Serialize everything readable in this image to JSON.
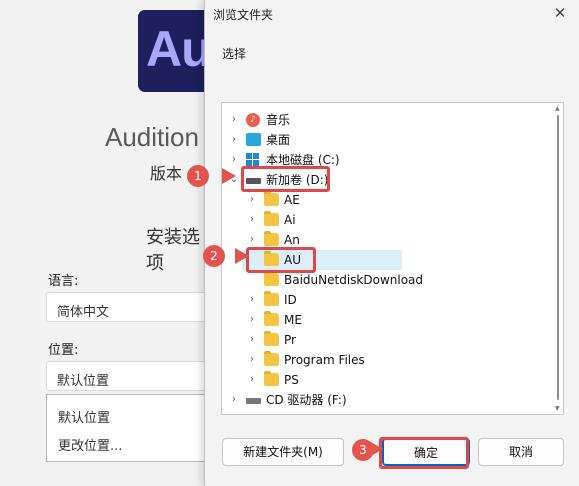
{
  "background_app": {
    "logo_text": "Au",
    "app_title": "Audition",
    "version_label": "版本",
    "install_options_title": "安装选项",
    "language_label": "语言:",
    "language_value": "简体中文",
    "location_label": "位置:",
    "location_value": "默认位置",
    "location_options": [
      "默认位置",
      "更改位置..."
    ]
  },
  "dialog": {
    "title": "浏览文件夹",
    "close_glyph": "✕",
    "prompt": "选择",
    "tree": [
      {
        "label": "音乐",
        "icon": "music-icon",
        "chevron": "›"
      },
      {
        "label": "桌面",
        "icon": "desktop-icon",
        "chevron": "›"
      },
      {
        "label": "本地磁盘 (C:)",
        "icon": "windows-drive-icon",
        "chevron": "›"
      },
      {
        "label": "新加卷 (D:)",
        "icon": "drive-icon",
        "chevron": "⌄"
      },
      {
        "label": "AE",
        "icon": "folder-icon",
        "chevron": "›"
      },
      {
        "label": "Ai",
        "icon": "folder-icon",
        "chevron": "›"
      },
      {
        "label": "An",
        "icon": "folder-icon",
        "chevron": "›"
      },
      {
        "label": "AU",
        "icon": "folder-icon",
        "chevron": "",
        "selected": true
      },
      {
        "label": "BaiduNetdiskDownload",
        "icon": "folder-icon",
        "chevron": ""
      },
      {
        "label": "ID",
        "icon": "folder-icon",
        "chevron": "›"
      },
      {
        "label": "ME",
        "icon": "folder-icon",
        "chevron": "›"
      },
      {
        "label": "Pr",
        "icon": "folder-icon",
        "chevron": "›"
      },
      {
        "label": "Program Files",
        "icon": "folder-icon",
        "chevron": "›"
      },
      {
        "label": "PS",
        "icon": "folder-icon",
        "chevron": "›"
      },
      {
        "label": "CD 驱动器 (F:)",
        "icon": "cd-drive-icon",
        "chevron": "›"
      }
    ],
    "new_folder_label": "新建文件夹(M)",
    "ok_label": "确定",
    "cancel_label": "取消"
  },
  "annotations": {
    "step1": "1",
    "step2": "2",
    "step3": "3",
    "highlight_color": "#e04848"
  }
}
